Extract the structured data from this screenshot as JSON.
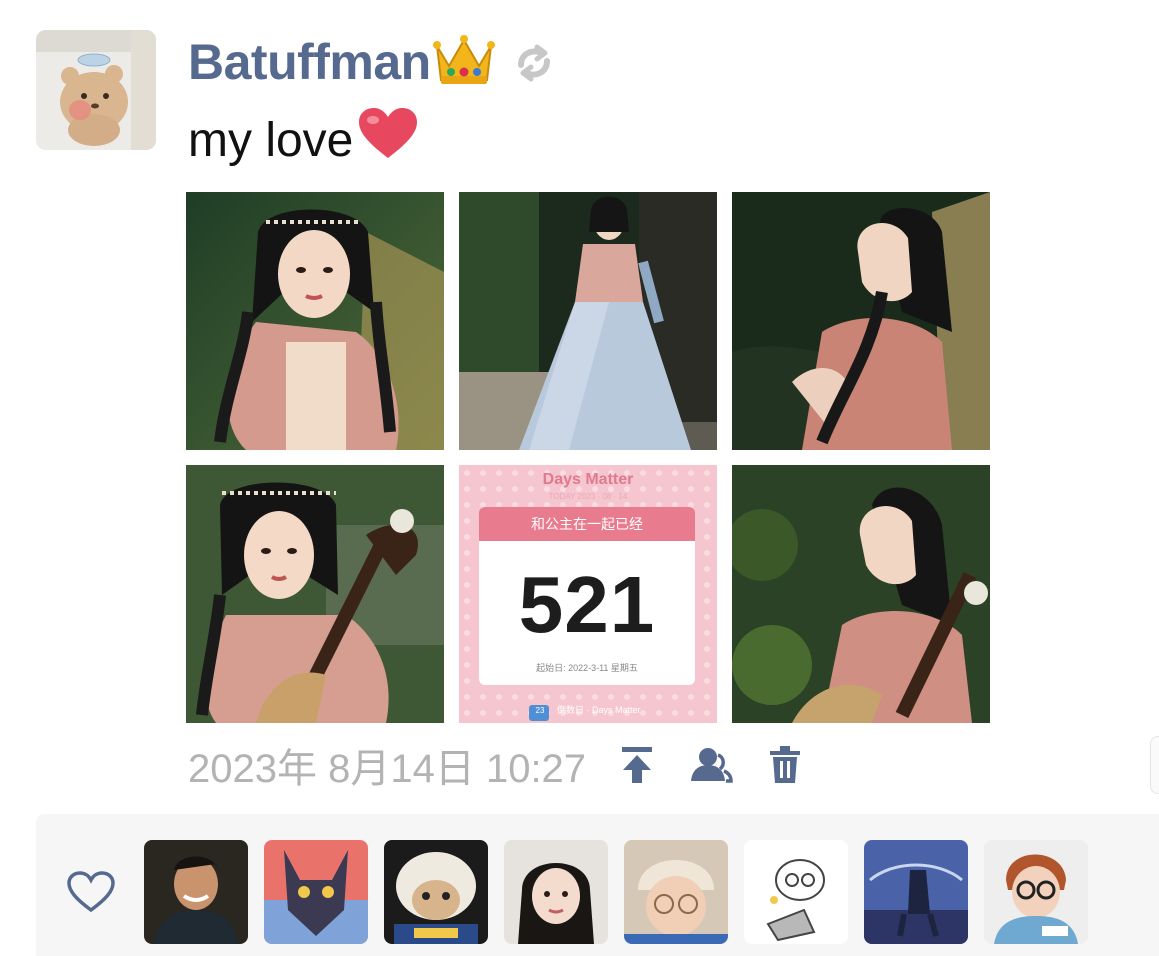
{
  "post": {
    "author": "Batuffman",
    "author_emoji": "👑",
    "text": "my love",
    "text_emoji": "❤️",
    "timestamp": "2023年 8月14日 10:27"
  },
  "days_matter": {
    "title": "Days Matter",
    "today_label": "TODAY 2023 · 08 · 14",
    "event": "和公主在一起已经",
    "days": "521",
    "start_date": "起始日: 2022-3-11 星期五",
    "footer": "倒数日 · Days Matter",
    "calendar_day": "23"
  },
  "actions": {
    "icons": [
      "pin-top-icon",
      "visibility-icon",
      "delete-icon"
    ]
  },
  "likes": {
    "icon": "heart-outline-icon",
    "count_shown": 8
  },
  "colors": {
    "author_name": "#56698f",
    "timestamp": "#b3b3b3",
    "action_icons": "#56698f",
    "panel_bg": "#f6f6f6",
    "days_pink": "#e97b8f"
  }
}
